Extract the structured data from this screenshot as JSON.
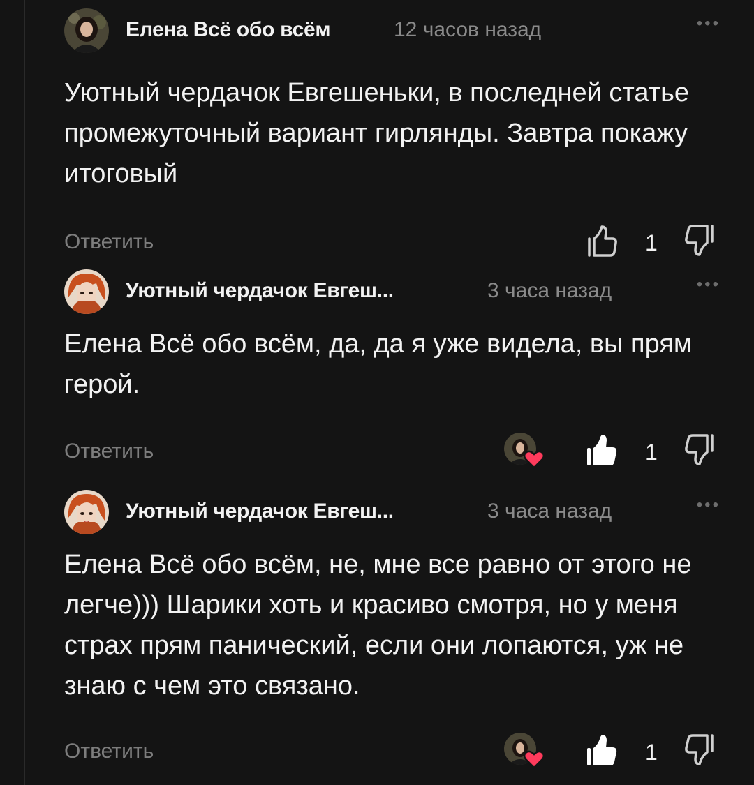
{
  "comments": [
    {
      "author": "Елена Всё обо всём",
      "time": "12 часов назад",
      "text": "Уютный чердачок Евгешеньки, в последней статье промежуточный вариант гирлянды. Завтра покажу итоговый",
      "reply_label": "Ответить",
      "likes": "1",
      "liked": false,
      "author_liked": false,
      "more_icon": "more-dots-icon"
    },
    {
      "author": "Уютный чердачок Евгеш...",
      "time": "3 часа назад",
      "text": "Елена Всё обо всём, да, да я уже видела, вы прям герой.",
      "reply_label": "Ответить",
      "likes": "1",
      "liked": true,
      "author_liked": true,
      "more_icon": "more-dots-icon"
    },
    {
      "author": "Уютный чердачок Евгеш...",
      "time": "3 часа назад",
      "text": "Елена Всё обо всём, не, мне все равно от этого не легче))) Шарики хоть и красиво смотря, но у меня страх прям панический, если они лопаются, уж не знаю с чем это связано.",
      "reply_label": "Ответить",
      "likes": "1",
      "liked": true,
      "author_liked": true,
      "more_icon": "more-dots-icon"
    }
  ],
  "colors": {
    "background": "#141414",
    "text": "#f2f2f2",
    "muted": "#8a8a8a",
    "heart": "#ff3b5c"
  }
}
